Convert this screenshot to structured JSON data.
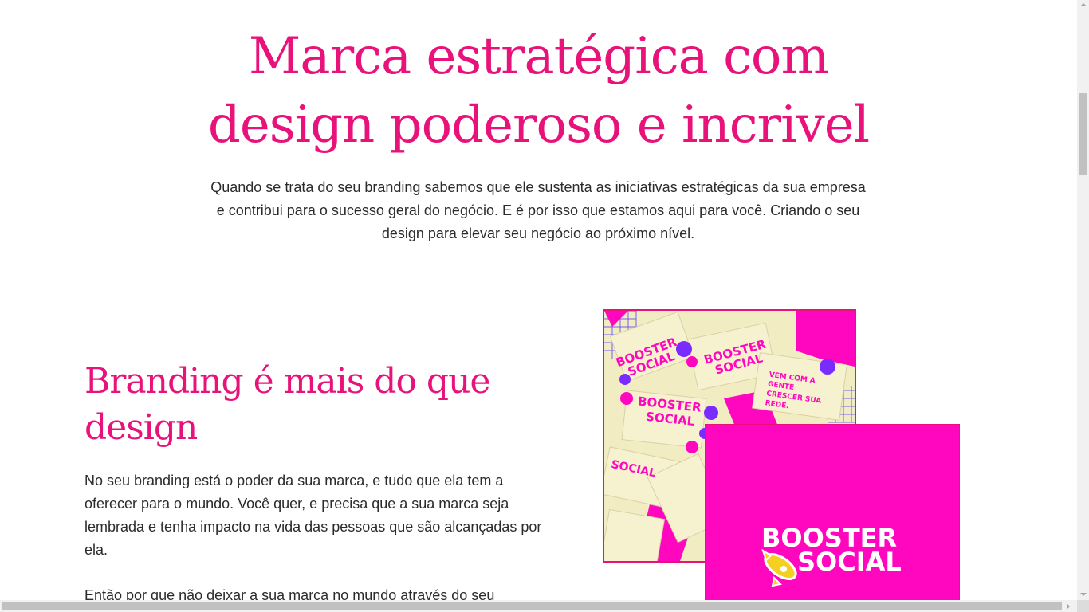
{
  "hero": {
    "title_line1": "Marca estratégica com",
    "title_line2": "design poderoso e incrivel",
    "text": "Quando se trata do seu branding sabemos que ele sustenta as iniciativas estratégicas da sua empresa e contribui para o sucesso geral do negócio. E é por isso que estamos aqui para você. Criando o seu design para elevar seu negócio ao próximo nível."
  },
  "section": {
    "title": "Branding é mais do que design",
    "paragraph1": "No seu branding está o poder da sua marca, e tudo que ela tem a oferecer para o mundo. Você quer, e precisa que a sua marca seja lembrada e tenha impacto na vida das pessoas que são alcançadas por ela.",
    "paragraph2": "Então por que não deixar a sua marca no mundo através do seu"
  },
  "images": {
    "cards": {
      "logo_line1": "BOOSTER",
      "logo_line2": "SOCIAL",
      "tagline": "VEM COM A GENTE CRESCER SUA REDE.",
      "alt_line1": "BOOSTER",
      "alt_line2": "SOCIAL"
    },
    "brand": {
      "logo_line1": "BOOSTER",
      "logo_line2": "SOCIAL"
    }
  },
  "colors": {
    "accent": "#e8137a",
    "brand_pink": "#ff07be",
    "card_cream": "#f1ecc2",
    "purple": "#7a2cff"
  }
}
